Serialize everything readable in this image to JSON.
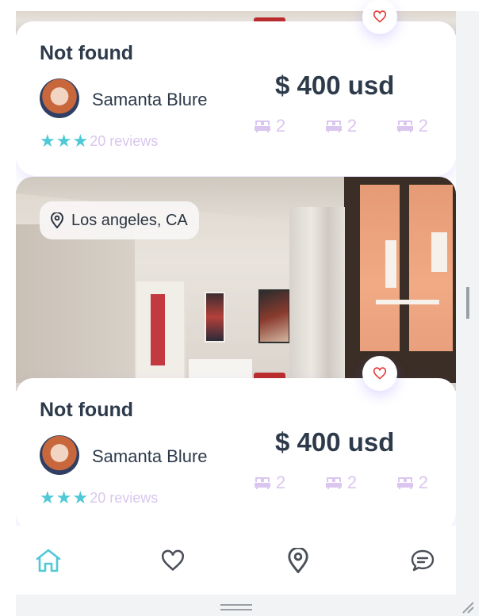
{
  "listings": [
    {
      "title": "Not found",
      "owner": "Samanta Blure",
      "rating_stars": 3,
      "reviews": "20 reviews",
      "price": "$ 400 usd",
      "features": [
        {
          "icon": "bed-icon",
          "count": "2"
        },
        {
          "icon": "bed-icon",
          "count": "2"
        },
        {
          "icon": "bed-icon",
          "count": "2"
        }
      ]
    },
    {
      "location": "Los angeles, CA",
      "title": "Not found",
      "owner": "Samanta Blure",
      "rating_stars": 3,
      "reviews": "20 reviews",
      "price": "$ 400 usd",
      "features": [
        {
          "icon": "bed-icon",
          "count": "2"
        },
        {
          "icon": "bed-icon",
          "count": "2"
        },
        {
          "icon": "bed-icon",
          "count": "2"
        }
      ]
    }
  ],
  "nav": {
    "items": [
      {
        "icon": "home-icon",
        "active": true
      },
      {
        "icon": "heart-icon",
        "active": false
      },
      {
        "icon": "location-pin-icon",
        "active": false
      },
      {
        "icon": "chat-icon",
        "active": false
      }
    ]
  },
  "colors": {
    "accent": "#4fc9d6",
    "text": "#2d3a4a",
    "muted": "#dbc6f0",
    "favorite": "#e53935"
  }
}
